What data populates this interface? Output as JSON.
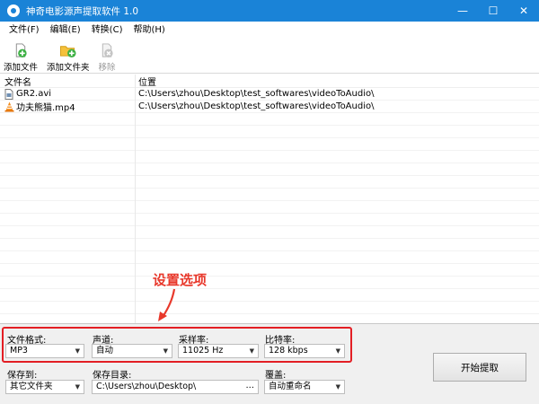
{
  "window": {
    "title": "神奇电影源声提取软件 1.0",
    "controls": [
      "—",
      "☐",
      "✕"
    ]
  },
  "menu": [
    "文件(F)",
    "编辑(E)",
    "转换(C)",
    "帮助(H)"
  ],
  "toolbar": {
    "add_file": "添加文件",
    "add_folder": "添加文件夹",
    "remove": "移除"
  },
  "list": {
    "headers": {
      "name": "文件名",
      "location": "位置"
    },
    "rows": [
      {
        "name": "GR2.avi",
        "icon": "avi-file-icon",
        "location": "C:\\Users\\zhou\\Desktop\\test_softwares\\videoToAudio\\"
      },
      {
        "name": "功夫熊猫.mp4",
        "icon": "vlc-cone-icon",
        "location": "C:\\Users\\zhou\\Desktop\\test_softwares\\videoToAudio\\"
      }
    ]
  },
  "annotation": "设置选项",
  "settings": {
    "format": {
      "label": "文件格式:",
      "value": "MP3"
    },
    "channel": {
      "label": "声道:",
      "value": "自动"
    },
    "sample_rate": {
      "label": "采样率:",
      "value": "11025 Hz"
    },
    "bitrate": {
      "label": "比特率:",
      "value": "128 kbps"
    },
    "save_to": {
      "label": "保存到:",
      "value": "其它文件夹"
    },
    "save_dir": {
      "label": "保存目录:",
      "value": "C:\\Users\\zhou\\Desktop\\",
      "browse": "..."
    },
    "overwrite": {
      "label": "覆盖:",
      "value": "自动重命名"
    }
  },
  "start_button": "开始提取",
  "colors": {
    "titlebar": "#1a83d7",
    "highlight": "#e31e24"
  }
}
